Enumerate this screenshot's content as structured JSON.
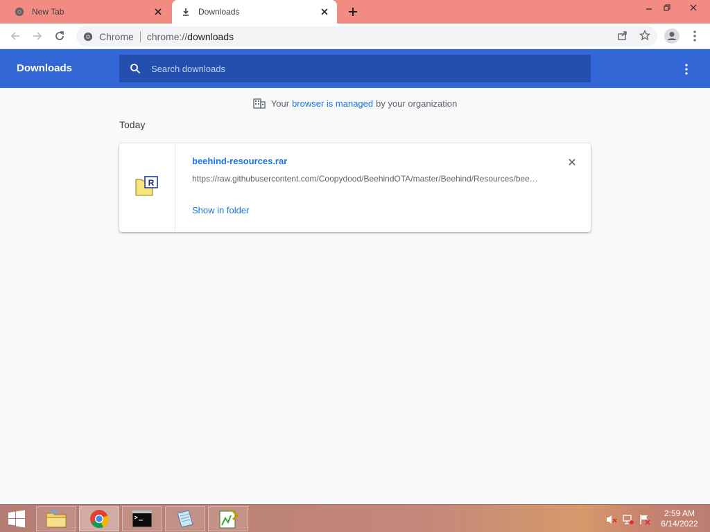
{
  "tabs": [
    {
      "title": "New Tab",
      "icon": "chrome-icon"
    },
    {
      "title": "Downloads",
      "icon": "download-icon"
    }
  ],
  "omnibox": {
    "chip": "Chrome",
    "url_prefix": "chrome://",
    "url_host": "downloads"
  },
  "header": {
    "title": "Downloads",
    "search_placeholder": "Search downloads"
  },
  "managed": {
    "prefix": "Your",
    "link": "browser is managed",
    "suffix": "by your organization"
  },
  "date_heading": "Today",
  "download": {
    "file_name": "beehind-resources.rar",
    "url": "https://raw.githubusercontent.com/Coopydood/BeehindOTA/master/Beehind/Resources/beehind-resources.rar",
    "action": "Show in folder"
  },
  "taskbar": {
    "apps": [
      "file-explorer",
      "chrome",
      "command-prompt",
      "notepad",
      "editor"
    ],
    "time": "2:59 AM",
    "date": "6/14/2022"
  },
  "colors": {
    "titlebar": "#f28b82",
    "header": "#3367d6",
    "search": "#254fae",
    "link": "#1a73e8"
  }
}
